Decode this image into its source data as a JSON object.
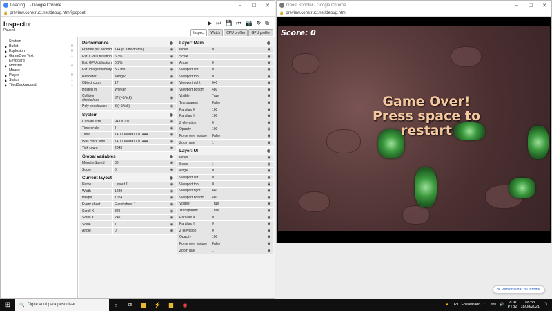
{
  "left_window": {
    "title": "Loading... - Google Chrome",
    "url": "preview.construct.net/debug.html?popout"
  },
  "inspector": {
    "title": "Inspector",
    "status": "Paused",
    "tabs": [
      "Inspect",
      "Watch",
      "CPU profiler",
      "GPU profiler"
    ]
  },
  "tree": [
    {
      "name": "System",
      "count": "",
      "expandable": false
    },
    {
      "name": "Bullet",
      "count": "0",
      "expandable": true
    },
    {
      "name": "Explosion",
      "count": "0",
      "expandable": true
    },
    {
      "name": "GameOverText",
      "count": "1",
      "expandable": true
    },
    {
      "name": "Keyboard",
      "count": "",
      "expandable": false
    },
    {
      "name": "Monster",
      "count": "14",
      "expandable": true
    },
    {
      "name": "Mouse",
      "count": "",
      "expandable": false
    },
    {
      "name": "Player",
      "count": "0",
      "expandable": true
    },
    {
      "name": "Status",
      "count": "1",
      "expandable": true
    },
    {
      "name": "TiledBackground",
      "count": "1",
      "expandable": true
    }
  ],
  "col1": [
    {
      "title": "Performance",
      "rows": [
        [
          "Frames per second",
          "144 (6.9 ms/frame)"
        ],
        [
          "Est. CPU utilisation",
          "6.3%"
        ],
        [
          "Est. GPU utilisation",
          "0.9%"
        ],
        [
          "Est. image memory",
          "3.2 mb"
        ],
        [
          "Renderer",
          "webgl2"
        ],
        [
          "Object count",
          "17"
        ],
        [
          "Hosted in",
          "Worker"
        ],
        [
          "Collision checks/sec",
          "37 (~0/tick)"
        ],
        [
          "Poly checks/sec",
          "8 (~0/tick)"
        ]
      ]
    },
    {
      "title": "System",
      "rows": [
        [
          "Canvas size",
          "943 x 707"
        ],
        [
          "Time scale",
          "1"
        ],
        [
          "Time",
          "14.173880000011444"
        ],
        [
          "Wall clock time",
          "14.173880000011444"
        ],
        [
          "Tick count",
          "2043"
        ]
      ]
    },
    {
      "title": "Global variables",
      "rows": [
        [
          "MonsterSpeed",
          "80"
        ],
        [
          "Score",
          "0"
        ]
      ]
    },
    {
      "title": "Current layout",
      "rows": [
        [
          "Name",
          "Layout 1"
        ],
        [
          "Width",
          "1280"
        ],
        [
          "Height",
          "1024"
        ],
        [
          "Event sheet",
          "Event sheet 1"
        ],
        [
          "Scroll X",
          "320"
        ],
        [
          "Scroll Y",
          "240"
        ],
        [
          "Scale",
          "1"
        ],
        [
          "Angle",
          "0"
        ]
      ]
    }
  ],
  "col2": [
    {
      "title": "Layer: Main",
      "rows": [
        [
          "Index",
          "0"
        ],
        [
          "Scale",
          "1"
        ],
        [
          "Angle",
          "0"
        ],
        [
          "Viewport left",
          "0"
        ],
        [
          "Viewport top",
          "0"
        ],
        [
          "Viewport right",
          "640"
        ],
        [
          "Viewport bottom",
          "480"
        ],
        [
          "Visible",
          "True"
        ],
        [
          "Transparent",
          "False"
        ],
        [
          "Parallax X",
          "100"
        ],
        [
          "Parallax Y",
          "100"
        ],
        [
          "Z elevation",
          "0"
        ],
        [
          "Opacity",
          "100"
        ],
        [
          "Force own texture",
          "False"
        ],
        [
          "Zoom rate",
          "1"
        ]
      ]
    },
    {
      "title": "Layer: UI",
      "rows": [
        [
          "Index",
          "1"
        ],
        [
          "Scale",
          "1"
        ],
        [
          "Angle",
          "0"
        ],
        [
          "Viewport left",
          "0"
        ],
        [
          "Viewport top",
          "0"
        ],
        [
          "Viewport right",
          "640"
        ],
        [
          "Viewport bottom",
          "480"
        ],
        [
          "Visible",
          "True"
        ],
        [
          "Transparent",
          "True"
        ],
        [
          "Parallax X",
          "0"
        ],
        [
          "Parallax Y",
          "0"
        ],
        [
          "Z elevation",
          "0"
        ],
        [
          "Opacity",
          "100"
        ],
        [
          "Force own texture",
          "False"
        ],
        [
          "Zoom rate",
          "1"
        ]
      ]
    }
  ],
  "right_window": {
    "title": "Ghost Shooter - Google Chrome",
    "url": "preview.construct.net/debug.html"
  },
  "game": {
    "score_text": "Score: 0",
    "gameover_line1": "Game Over!",
    "gameover_line2": "Press space to",
    "gameover_line3": "restart"
  },
  "chrome_button": "Personalizar o Chrome",
  "taskbar": {
    "search_placeholder": "Digite aqui para pesquisar",
    "weather": "16°C Ensolarado",
    "lang1": "POR",
    "lang2": "PTB2",
    "time": "08:33",
    "date": "18/08/2021"
  }
}
